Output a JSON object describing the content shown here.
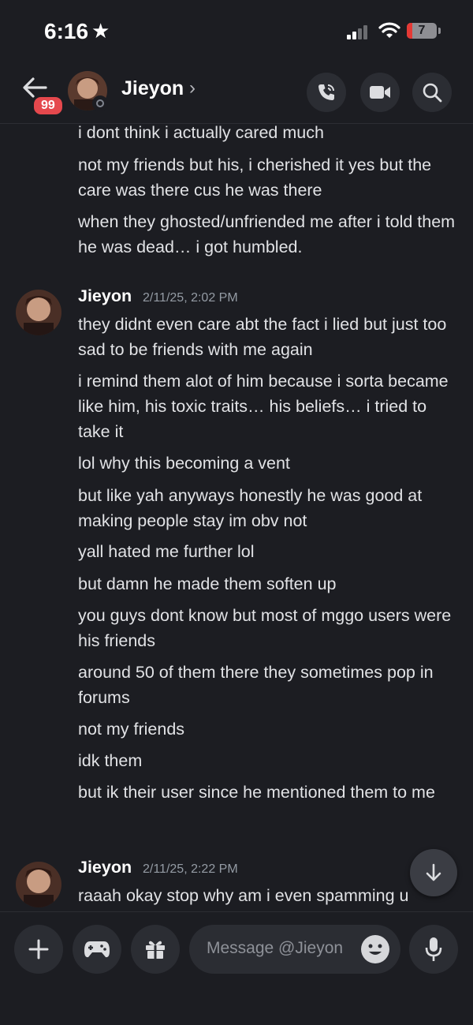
{
  "status_bar": {
    "time": "6:16",
    "battery": "7"
  },
  "header": {
    "unread_count": "99",
    "contact_name": "Jieyon",
    "chevron": "›"
  },
  "continued_lines": [
    "i dont think i actually cared much",
    "not my friends but his, i cherished it yes but the care was there cus he was there",
    "when they ghosted/unfriended me after i told them he was dead… i got humbled."
  ],
  "groups": [
    {
      "author": "Jieyon",
      "timestamp": "2/11/25, 2:02 PM",
      "lines": [
        "they didnt even care abt the fact i lied but just too sad to be friends with me again",
        "i remind them alot of him because i sorta became like him, his toxic traits… his beliefs… i tried to take it",
        "lol why this becoming a vent",
        "but like yah anyways honestly he was good at making people stay im obv not",
        "yall hated me further lol",
        "but damn he made them soften up",
        "you guys dont know but most of mggo users were his friends",
        "around 50 of them there they sometimes pop in forums",
        "not my friends",
        "idk them",
        "but ik their user since he mentioned them to me"
      ]
    },
    {
      "author": "Jieyon",
      "timestamp": "2/11/25, 2:22 PM",
      "lines": [
        "raaah okay stop why am i even spamming u"
      ]
    }
  ],
  "composer": {
    "placeholder": "Message @Jieyon"
  },
  "colors": {
    "background": "#1c1d22",
    "surface": "#2b2d33",
    "badge": "#e5484d",
    "timestamp": "#949ba4"
  }
}
